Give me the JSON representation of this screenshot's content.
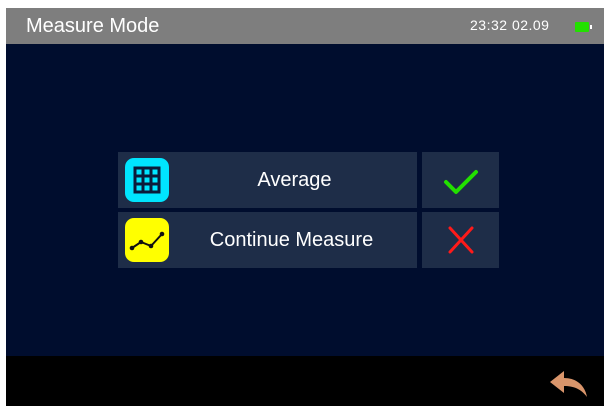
{
  "header": {
    "title": "Measure Mode",
    "time": "23:32",
    "date": "02.09",
    "battery_icon": "battery-full-icon",
    "battery_color": "#22e000"
  },
  "options": [
    {
      "label": "Average",
      "icon": "grid-icon",
      "icon_color": "#00e5ff",
      "action_icon": "check-icon",
      "action_color": "#22e000"
    },
    {
      "label": "Continue Measure",
      "icon": "line-chart-icon",
      "icon_color": "#ffff00",
      "action_icon": "cross-icon",
      "action_color": "#ff1a1a"
    }
  ],
  "footer": {
    "back_icon": "back-arrow-icon",
    "back_color": "#d9956b"
  },
  "colors": {
    "background": "#000d2e",
    "titlebar": "#7e7e7e",
    "button": "#1e2d48"
  }
}
